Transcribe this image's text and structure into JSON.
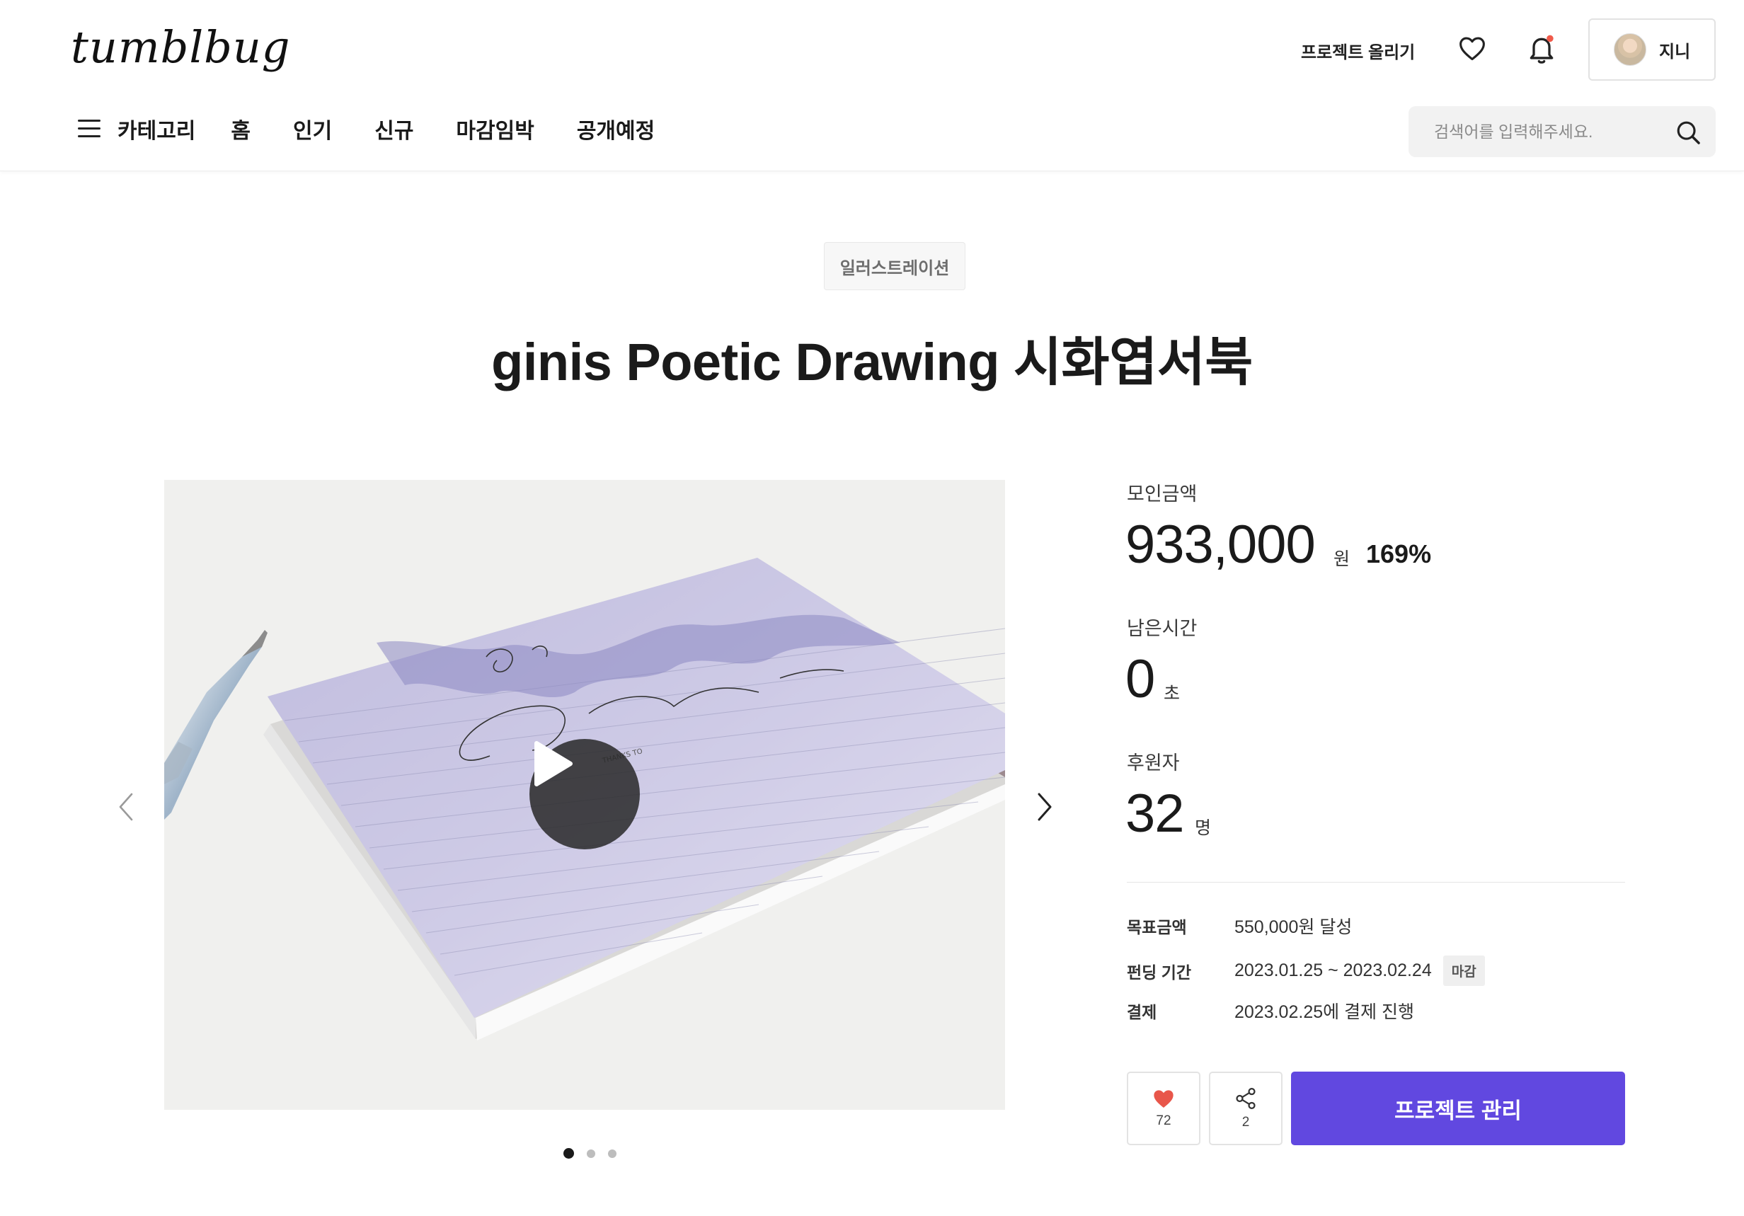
{
  "header": {
    "logo": "tumblbug",
    "upload_label": "프로젝트 올리기",
    "user_name": "지니",
    "icons": {
      "like": "heart-icon",
      "notifications": "bell-icon",
      "notification_dot_color": "#f05a4a"
    }
  },
  "nav": {
    "category_label": "카테고리",
    "items": [
      "홈",
      "인기",
      "신규",
      "마감임박",
      "공개예정"
    ]
  },
  "search": {
    "placeholder": "검색어를 입력해주세요."
  },
  "project": {
    "category": "일러스트레이션",
    "title": "ginis Poetic Drawing 시화엽서북"
  },
  "media": {
    "dots_total": 3,
    "dots_active": 0
  },
  "stats": {
    "raised_label": "모인금액",
    "raised_value": "933,000",
    "raised_unit": "원",
    "raised_percent": "169%",
    "time_label": "남은시간",
    "time_value": "0",
    "time_unit": "초",
    "backers_label": "후원자",
    "backers_value": "32",
    "backers_unit": "명"
  },
  "details": {
    "goal_key": "목표금액",
    "goal_value": "550,000원 달성",
    "period_key": "펀딩 기간",
    "period_value": "2023.01.25 ~ 2023.02.24",
    "period_tag": "마감",
    "payment_key": "결제",
    "payment_value": "2023.02.25에 결제 진행"
  },
  "actions": {
    "like_count": "72",
    "share_count": "2",
    "manage_label": "프로젝트 관리",
    "accent_color": "#6148e0",
    "like_color": "#e8564a"
  }
}
